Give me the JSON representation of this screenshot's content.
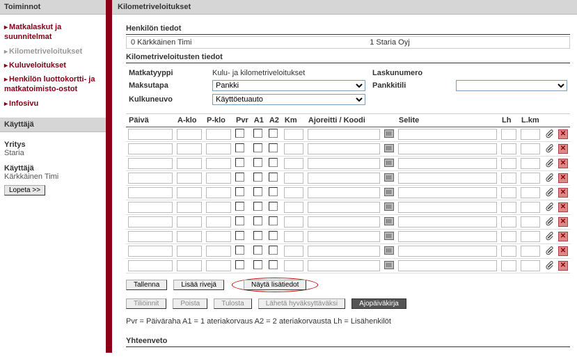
{
  "sidebar": {
    "header": "Toiminnot",
    "items": [
      {
        "label": "Matkalaskut ja suunnitelmat",
        "current": false
      },
      {
        "label": "Kilometriveloitukset",
        "current": true
      },
      {
        "label": "Kuluveloitukset",
        "current": false
      },
      {
        "label": "Henkilön luottokortti- ja matkatoimisto-ostot",
        "current": false
      },
      {
        "label": "Infosivu",
        "current": false
      }
    ],
    "user_header": "Käyttäjä",
    "company_label": "Yritys",
    "company_value": "Staria",
    "user_label": "Käyttäjä",
    "user_value": "Kärkkäinen Timi",
    "logout": "Lopeta >>"
  },
  "page": {
    "title": "Kilometriveloitukset",
    "person_section": "Henkilön tiedot",
    "person_left": "0 Kärkkäinen Timi",
    "person_right": "1 Staria Oyj",
    "details_section": "Kilometriveloitusten tiedot",
    "form": {
      "matkatyyppi_label": "Matkatyyppi",
      "matkatyyppi_value": "Kulu- ja kilometriveloitukset",
      "laskunumero_label": "Laskunumero",
      "laskunumero_value": "",
      "maksutapa_label": "Maksutapa",
      "maksutapa_value": "Pankki",
      "pankkitili_label": "Pankkitili",
      "pankkitili_value": "",
      "kulkuneuvo_label": "Kulkuneuvo",
      "kulkuneuvo_value": "Käyttöetuauto"
    },
    "columns": {
      "paiva": "Päivä",
      "aklo": "A-klo",
      "pklo": "P-klo",
      "pvr": "Pvr",
      "a1": "A1",
      "a2": "A2",
      "km": "Km",
      "ajoreitti": "Ajoreitti / Koodi",
      "selite": "Selite",
      "lh": "Lh",
      "lkm": "L.km"
    },
    "row_count": 10,
    "buttons": {
      "tallenna": "Tallenna",
      "lisaa": "Lisää rivejä",
      "nayta": "Näytä lisätiedot",
      "tilioinnit": "Tiliöinnit",
      "poista": "Poista",
      "tulosta": "Tulosta",
      "laheta": "Lähetä hyväksyttäväksi",
      "ajopaivakirja": "Ajopäiväkirja"
    },
    "legend": "Pvr = Päiväraha    A1 = 1 ateriakorvaus    A2 = 2 ateriakorvausta    Lh = Lisähenkilöt",
    "footer": "Yhteenveto"
  }
}
